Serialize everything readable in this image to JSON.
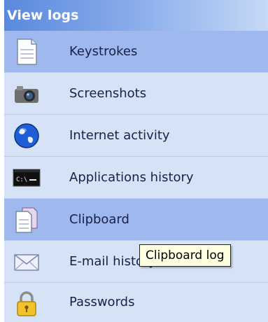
{
  "panel": {
    "title": "View logs",
    "items": [
      {
        "label": "Keystrokes",
        "icon": "document-icon",
        "highlighted": true
      },
      {
        "label": "Screenshots",
        "icon": "camera-icon",
        "highlighted": false
      },
      {
        "label": "Internet activity",
        "icon": "globe-icon",
        "highlighted": false
      },
      {
        "label": "Applications history",
        "icon": "terminal-icon",
        "highlighted": false
      },
      {
        "label": "Clipboard",
        "icon": "clipboard-icon",
        "highlighted": true
      },
      {
        "label": "E-mail history",
        "icon": "envelope-icon",
        "highlighted": false
      },
      {
        "label": "Passwords",
        "icon": "padlock-icon",
        "highlighted": false
      }
    ]
  },
  "tooltip": {
    "text": "Clipboard log"
  },
  "colors": {
    "header": "#5a89dc",
    "list_background": "#d6e2f6",
    "highlight": "#9fb8ee",
    "tooltip_background": "#ffffe1"
  }
}
